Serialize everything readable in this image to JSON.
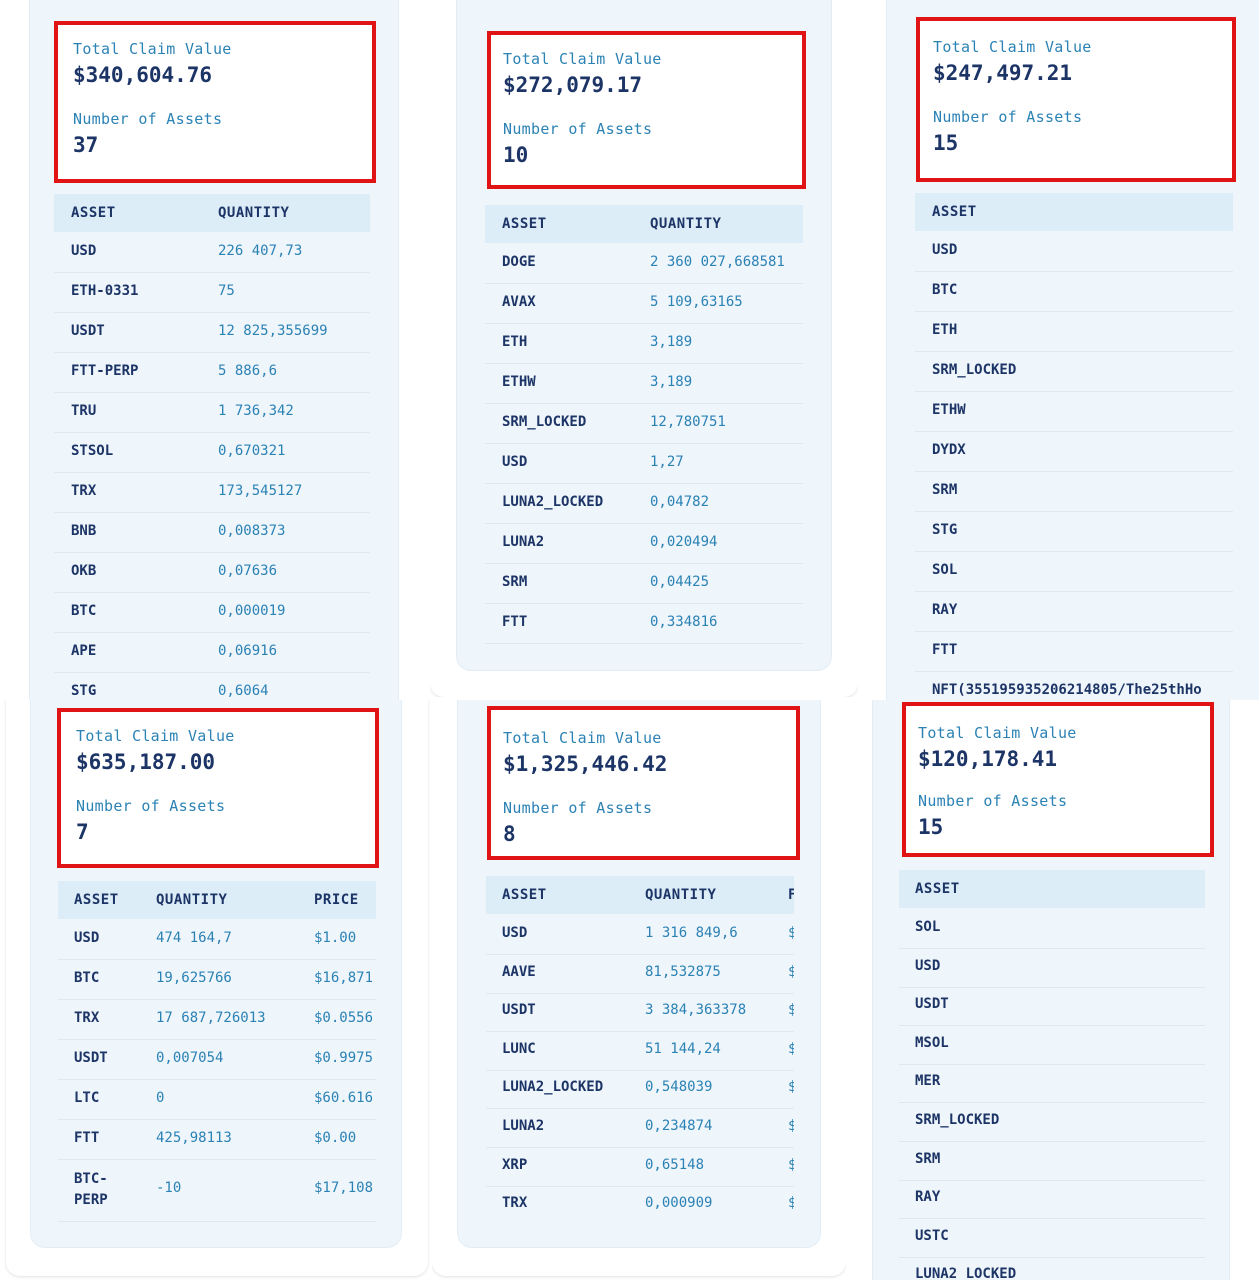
{
  "summary_labels": {
    "total": "Total Claim Value",
    "assets": "Number of Assets"
  },
  "headers": {
    "asset": "ASSET",
    "quantity": "QUANTITY",
    "price": "PRICE",
    "price_cut": "F"
  },
  "panels": [
    {
      "total": "$340,604.76",
      "count": "37",
      "rows": [
        {
          "asset": "USD",
          "qty": "226 407,73"
        },
        {
          "asset": "ETH-0331",
          "qty": "75"
        },
        {
          "asset": "USDT",
          "qty": "12 825,355699"
        },
        {
          "asset": "FTT-PERP",
          "qty": "5 886,6"
        },
        {
          "asset": "TRU",
          "qty": "1 736,342"
        },
        {
          "asset": "STSOL",
          "qty": "0,670321"
        },
        {
          "asset": "TRX",
          "qty": "173,545127"
        },
        {
          "asset": "BNB",
          "qty": "0,008373"
        },
        {
          "asset": "OKB",
          "qty": "0,07636"
        },
        {
          "asset": "BTC",
          "qty": "0,000019"
        },
        {
          "asset": "APE",
          "qty": "0,06916"
        },
        {
          "asset": "STG",
          "qty": "0,6064"
        }
      ]
    },
    {
      "total": "$272,079.17",
      "count": "10",
      "rows": [
        {
          "asset": "DOGE",
          "qty": "2 360 027,668581"
        },
        {
          "asset": "AVAX",
          "qty": "5 109,63165"
        },
        {
          "asset": "ETH",
          "qty": "3,189"
        },
        {
          "asset": "ETHW",
          "qty": "3,189"
        },
        {
          "asset": "SRM_LOCKED",
          "qty": "12,780751"
        },
        {
          "asset": "USD",
          "qty": "1,27"
        },
        {
          "asset": "LUNA2_LOCKED",
          "qty": "0,04782"
        },
        {
          "asset": "LUNA2",
          "qty": "0,020494"
        },
        {
          "asset": "SRM",
          "qty": "0,04425"
        },
        {
          "asset": "FTT",
          "qty": "0,334816"
        }
      ]
    },
    {
      "total": "$247,497.21",
      "count": "15",
      "rows": [
        {
          "asset": "USD"
        },
        {
          "asset": "BTC"
        },
        {
          "asset": "ETH"
        },
        {
          "asset": "SRM_LOCKED"
        },
        {
          "asset": "ETHW"
        },
        {
          "asset": "DYDX"
        },
        {
          "asset": "SRM"
        },
        {
          "asset": "STG"
        },
        {
          "asset": "SOL"
        },
        {
          "asset": "RAY"
        },
        {
          "asset": "FTT"
        },
        {
          "asset": "NFT(355195935206214805/The25thHo"
        }
      ]
    },
    {
      "total": "$635,187.00",
      "count": "7",
      "rows": [
        {
          "asset": "USD",
          "qty": "474 164,7",
          "price": "$1.00"
        },
        {
          "asset": "BTC",
          "qty": "19,625766",
          "price": "$16,871"
        },
        {
          "asset": "TRX",
          "qty": "17 687,726013",
          "price": "$0.0556"
        },
        {
          "asset": "USDT",
          "qty": "0,007054",
          "price": "$0.9975"
        },
        {
          "asset": "LTC",
          "qty": "0",
          "price": "$60.616"
        },
        {
          "asset": "FTT",
          "qty": "425,98113",
          "price": "$0.00"
        },
        {
          "asset": "BTC-\nPERP",
          "qty": "-10",
          "price": "$17,108"
        }
      ]
    },
    {
      "total": "$1,325,446.42",
      "count": "8",
      "rows": [
        {
          "asset": "USD",
          "qty": "1 316 849,6",
          "price": "$"
        },
        {
          "asset": "AAVE",
          "qty": "81,532875",
          "price": "$"
        },
        {
          "asset": "USDT",
          "qty": "3 384,363378",
          "price": "$"
        },
        {
          "asset": "LUNC",
          "qty": "51 144,24",
          "price": "$"
        },
        {
          "asset": "LUNA2_LOCKED",
          "qty": "0,548039",
          "price": "$"
        },
        {
          "asset": "LUNA2",
          "qty": "0,234874",
          "price": "$"
        },
        {
          "asset": "XRP",
          "qty": "0,65148",
          "price": "$"
        },
        {
          "asset": "TRX",
          "qty": "0,000909",
          "price": "$"
        }
      ]
    },
    {
      "total": "$120,178.41",
      "count": "15",
      "rows": [
        {
          "asset": "SOL"
        },
        {
          "asset": "USD"
        },
        {
          "asset": "USDT"
        },
        {
          "asset": "MSOL"
        },
        {
          "asset": "MER"
        },
        {
          "asset": "SRM_LOCKED"
        },
        {
          "asset": "SRM"
        },
        {
          "asset": "RAY"
        },
        {
          "asset": "USTC"
        },
        {
          "asset": "LUNA2_LOCKED"
        }
      ]
    }
  ],
  "colors": {
    "border_red": "#e01414",
    "accent_blue": "#2b82b4",
    "navy": "#1d3566",
    "card_bg": "#eef5fb"
  }
}
